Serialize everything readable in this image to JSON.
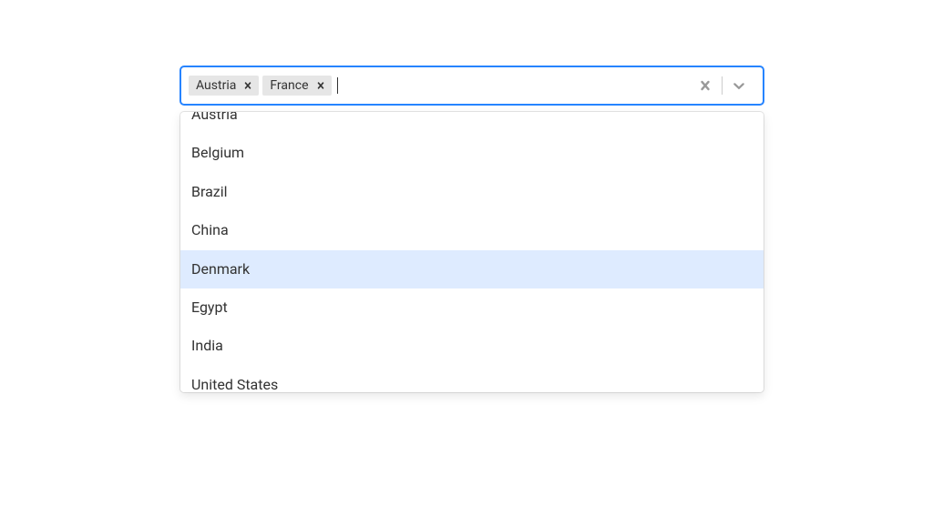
{
  "select": {
    "tags": [
      {
        "label": "Austria"
      },
      {
        "label": "France"
      }
    ],
    "options": [
      {
        "label": "Austria",
        "focused": false
      },
      {
        "label": "Belgium",
        "focused": false
      },
      {
        "label": "Brazil",
        "focused": false
      },
      {
        "label": "China",
        "focused": false
      },
      {
        "label": "Denmark",
        "focused": true
      },
      {
        "label": "Egypt",
        "focused": false
      },
      {
        "label": "India",
        "focused": false
      },
      {
        "label": "United States",
        "focused": false
      }
    ],
    "scrollTop": 22
  }
}
